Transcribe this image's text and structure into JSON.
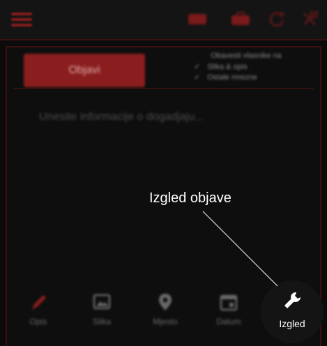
{
  "topbar": {
    "icons": [
      "menu-icon",
      "ticket-icon",
      "briefcase-icon",
      "refresh-icon",
      "share-icon"
    ]
  },
  "editor": {
    "publish_label": "Objavi",
    "notify_title": "Obavesti vlasnike na",
    "notify_options": [
      "Slika & opis",
      "Ostale mrezne"
    ],
    "placeholder": "Unesite informacije o dogadjaju..."
  },
  "tabs": [
    {
      "label": "Opis",
      "icon": "pencil-icon"
    },
    {
      "label": "Slika",
      "icon": "image-icon"
    },
    {
      "label": "Mjesto",
      "icon": "location-pin-icon"
    },
    {
      "label": "Datum",
      "icon": "calendar-icon"
    },
    {
      "label": "Izgled",
      "icon": "wrench-icon",
      "active": true
    }
  ],
  "annotation": {
    "text": "Izgled objave"
  },
  "colors": {
    "background": "#0b0b0b",
    "accent": "#8a1e1e",
    "active_label": "#ffffff"
  }
}
